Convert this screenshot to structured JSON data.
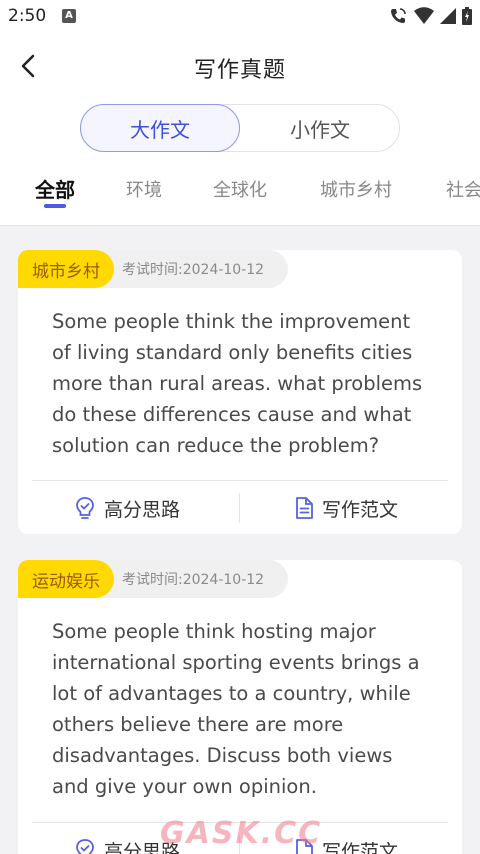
{
  "status": {
    "time": "2:50",
    "notif_letter": "A"
  },
  "header": {
    "title": "写作真题"
  },
  "segment": {
    "items": [
      "大作文",
      "小作文"
    ],
    "active": 0
  },
  "tabs": {
    "items": [
      "全部",
      "环境",
      "全球化",
      "城市乡村",
      "社会"
    ],
    "active": 0
  },
  "cards": [
    {
      "tag": "城市乡村",
      "date": "考试时间:2024-10-12",
      "text": "Some people think the improvement of living standard only benefits cities more than rural areas. what problems do these differences cause and what solution can reduce the problem?",
      "action_left": "高分思路",
      "action_right": "写作范文"
    },
    {
      "tag": "运动娱乐",
      "date": "考试时间:2024-10-12",
      "text": "Some people think hosting major international sporting events brings a lot of advantages to a country, while others believe there are more disadvantages. Discuss both views and give your own opinion.",
      "action_left": "高分思路",
      "action_right": "写作范文"
    }
  ],
  "watermark": "GASK.CC",
  "colors": {
    "accent": "#3f4fd8",
    "tag_bg": "#ffd900",
    "tag_text": "#9a5b00",
    "page_bg": "#f2f2f4"
  },
  "icons": [
    "back-arrow-icon",
    "bulb-icon",
    "document-icon",
    "wifi-icon",
    "signal-icon",
    "battery-icon",
    "call-icon"
  ]
}
